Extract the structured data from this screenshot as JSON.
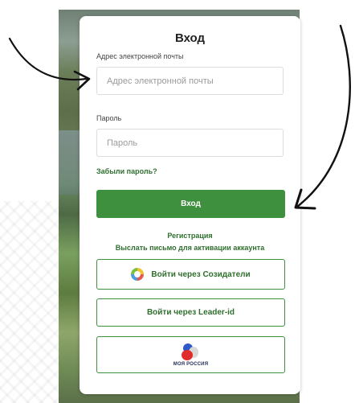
{
  "login": {
    "title": "Вход",
    "email_label": "Адрес электронной почты",
    "email_placeholder": "Адрес электронной почты",
    "password_label": "Пароль",
    "password_placeholder": "Пароль",
    "forgot_password": "Забыли пароль?",
    "submit_label": "Вход",
    "register_link": "Регистрация",
    "resend_activation_link": "Выслать письмо для активации аккаунта",
    "sozdateli_button": "Войти через Созидатели",
    "leader_id_button": "Войти через Leader-id",
    "moya_rossiya_logo_text": "МОЯ РОССИЯ"
  },
  "colors": {
    "primary": "#3e8f3e",
    "link": "#2e6f2e"
  },
  "icons": {
    "sozdateli": "sozdateli-icon",
    "moya_rossiya": "moya-rossiya-logo",
    "arrows": "hand-drawn-arrow-icon"
  }
}
